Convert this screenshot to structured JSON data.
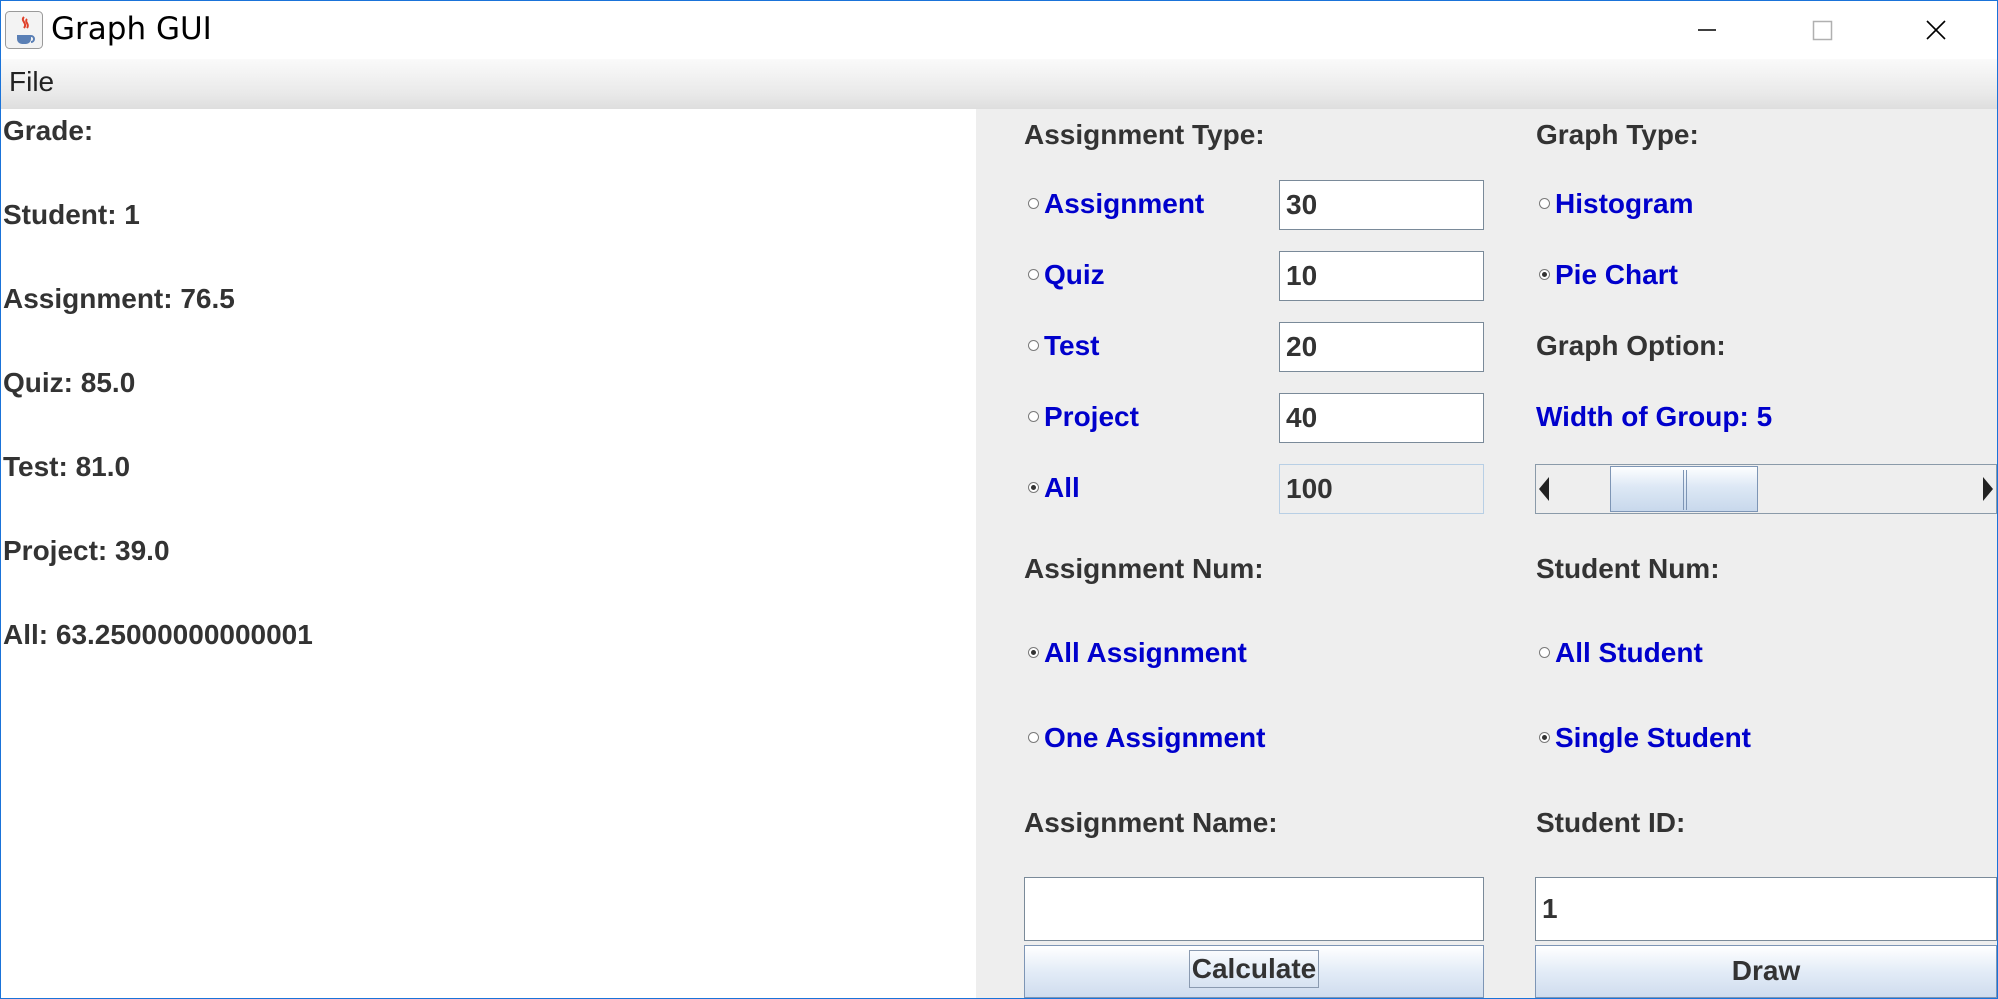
{
  "window": {
    "title": "Graph GUI"
  },
  "menubar": {
    "file": "File"
  },
  "grades": {
    "heading": "Grade:",
    "lines": [
      "Student: 1",
      "Assignment: 76.5",
      "Quiz: 85.0",
      "Test: 81.0",
      "Project: 39.0",
      "All: 63.25000000000001"
    ]
  },
  "assignment_type": {
    "label": "Assignment Type:",
    "options": [
      {
        "label": "Assignment",
        "selected": false,
        "weight": "30"
      },
      {
        "label": "Quiz",
        "selected": false,
        "weight": "10"
      },
      {
        "label": "Test",
        "selected": false,
        "weight": "20"
      },
      {
        "label": "Project",
        "selected": false,
        "weight": "40"
      },
      {
        "label": "All",
        "selected": true,
        "weight": "100"
      }
    ]
  },
  "graph_type": {
    "label": "Graph Type:",
    "options": [
      {
        "label": "Histogram",
        "selected": false
      },
      {
        "label": "Pie Chart",
        "selected": true
      }
    ]
  },
  "graph_option": {
    "label": "Graph Option:",
    "width_label": "Width of Group: 5",
    "width_value": 5
  },
  "assignment_num": {
    "label": "Assignment Num:",
    "options": [
      {
        "label": "All Assignment",
        "selected": true
      },
      {
        "label": "One Assignment",
        "selected": false
      }
    ]
  },
  "student_num": {
    "label": "Student Num:",
    "options": [
      {
        "label": "All Student",
        "selected": false
      },
      {
        "label": "Single Student",
        "selected": true
      }
    ]
  },
  "assignment_name": {
    "label": "Assignment Name:",
    "value": ""
  },
  "student_id": {
    "label": "Student ID:",
    "value": "1"
  },
  "buttons": {
    "calculate": "Calculate",
    "draw": "Draw"
  }
}
